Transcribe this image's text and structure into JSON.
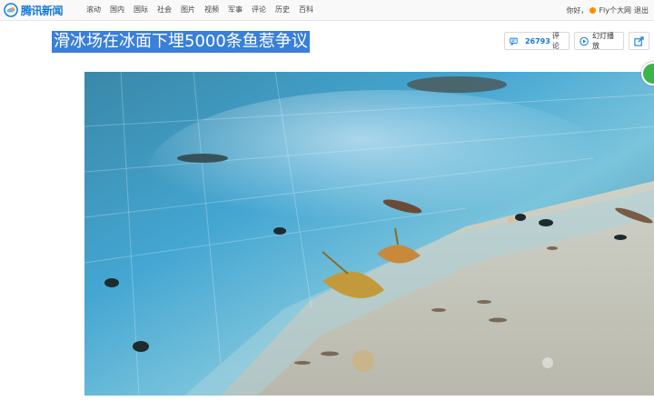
{
  "header": {
    "logo_text": "腾讯新闻",
    "nav": [
      "滚动",
      "国内",
      "国际",
      "社会",
      "图片",
      "视频",
      "军事",
      "评论",
      "历史",
      "百科"
    ],
    "greeting": "你好，",
    "username": "Fly个大网",
    "logout": "退出"
  },
  "article": {
    "title": "滑冰场在冰面下埋5000条鱼惹争议",
    "comment_count": "26793",
    "comment_label": "评论",
    "slideshow_label": "幻灯播放"
  },
  "colors": {
    "brand": "#1479d7",
    "title_highlight": "#3a7fd8",
    "side_badge": "#3bb54a"
  },
  "icons": [
    "tencent-news-logo-icon",
    "comment-icon",
    "play-icon",
    "share-icon",
    "qq-icon"
  ]
}
